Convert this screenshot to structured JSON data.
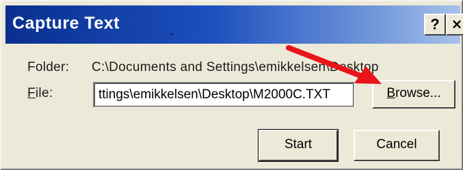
{
  "window": {
    "title": "Capture Text",
    "help_glyph": "?",
    "close_glyph": "×"
  },
  "form": {
    "folder_label": "Folder:",
    "folder_path": "C:\\Documents and Settings\\emikkelsen\\Desktop",
    "file_label_accel": "F",
    "file_label_rest": "ile:",
    "file_value": "ttings\\emikkelsen\\Desktop\\M2000C.TXT"
  },
  "buttons": {
    "browse_accel": "B",
    "browse_rest": "rowse...",
    "start": "Start",
    "cancel": "Cancel"
  },
  "colors": {
    "titlebar_start": "#0a2f8f",
    "titlebar_end": "#a7c1ea",
    "dialog_face": "#ece9d8",
    "annotation_arrow": "#e8141a"
  }
}
